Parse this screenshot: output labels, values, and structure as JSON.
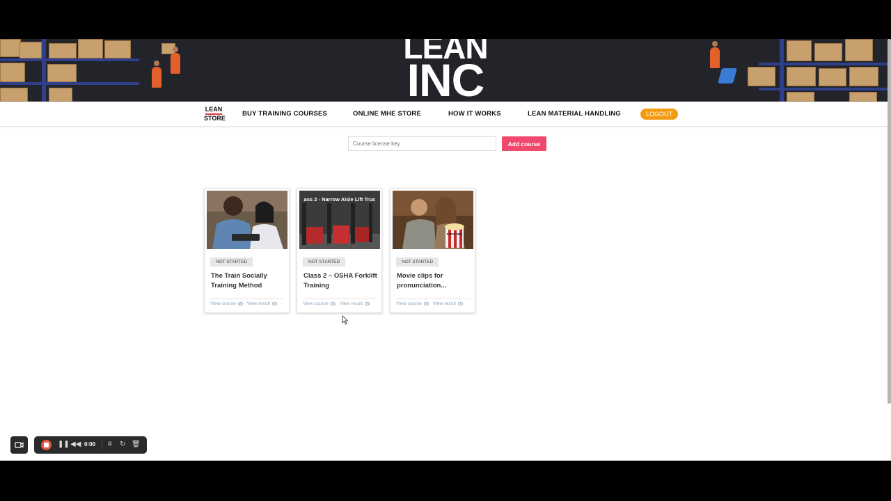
{
  "hero": {
    "title_line1": "LEAN",
    "title_line2": "INC"
  },
  "nav": {
    "logo_top": "LEAN",
    "logo_bottom": "STORE",
    "items": [
      {
        "label": "BUY TRAINING COURSES"
      },
      {
        "label": "ONLINE MHE STORE"
      },
      {
        "label": "HOW IT WORKS"
      },
      {
        "label": "LEAN MATERIAL HANDLING"
      }
    ],
    "logout_label": "LOGOUT"
  },
  "add_course": {
    "placeholder": "Course license key",
    "value": "",
    "button_label": "Add course"
  },
  "courses": [
    {
      "status": "NOT STARTED",
      "title": "The Train Socially Training Method",
      "view_course": "View course",
      "view_result": "View result"
    },
    {
      "status": "NOT STARTED",
      "title": "Class 2 – OSHA Forklift Training",
      "thumb_caption": "ass 2 - Narrow Aisle Lift Truc",
      "view_course": "View course",
      "view_result": "View result"
    },
    {
      "status": "NOT STARTED",
      "title": "Movie clips for pronunciation...",
      "thumb_caption": "POPCORN",
      "view_course": "View course",
      "view_result": "View result"
    }
  ],
  "recorder": {
    "time": "0:00"
  },
  "colors": {
    "hero_bg": "#22242a",
    "accent_pink": "#f1486e",
    "logout_orange": "#f39c12",
    "link_blue": "#8aa2b8"
  }
}
